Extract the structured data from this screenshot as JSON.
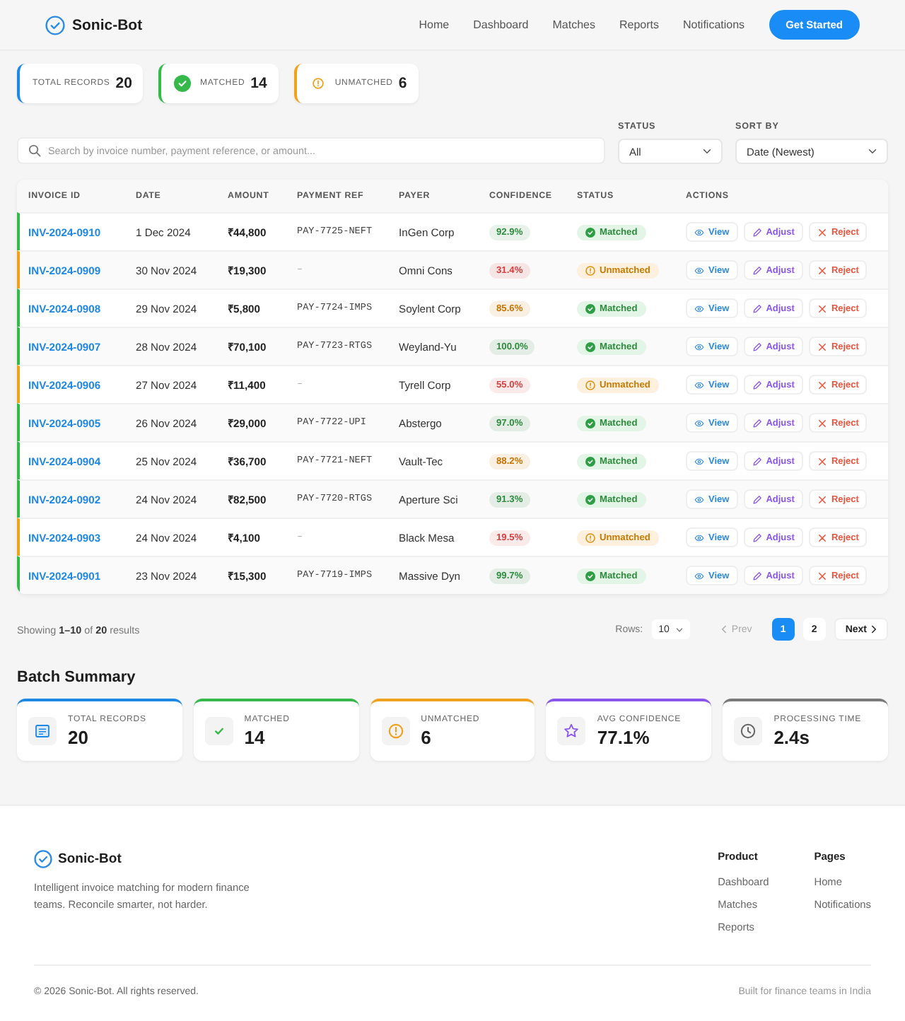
{
  "header": {
    "brand": "Sonic-Bot",
    "nav": [
      "Home",
      "Dashboard",
      "Matches",
      "Reports",
      "Notifications"
    ],
    "cta": "Get Started"
  },
  "stats": [
    {
      "kind": "total",
      "label": "TOTAL RECORDS",
      "value": "20"
    },
    {
      "kind": "matched",
      "label": "MATCHED",
      "value": "14"
    },
    {
      "kind": "unmatched",
      "label": "UNMATCHED",
      "value": "6"
    }
  ],
  "filters": {
    "search": {
      "placeholder": "Search by invoice number, payment reference, or amount..."
    },
    "status": {
      "label": "STATUS",
      "value": "All"
    },
    "sort": {
      "label": "SORT BY",
      "value": "Date (Newest)"
    }
  },
  "table": {
    "columns": [
      "INVOICE ID",
      "DATE",
      "AMOUNT",
      "PAYMENT REF",
      "PAYER",
      "CONFIDENCE",
      "STATUS",
      "ACTIONS"
    ],
    "rows": [
      {
        "invoice_id": "INV-2024-0910",
        "date": "1 Dec 2024",
        "amount": "₹44,800",
        "payment_ref": "PAY-7725-NEFT",
        "payer": "InGen Corp",
        "confidence": {
          "value": "92.9%",
          "color": "#2e8b3e"
        },
        "matched": true,
        "status": "Matched",
        "actions": [
          {
            "kind": "view",
            "label": "View"
          },
          {
            "kind": "adjust",
            "label": "Adjust"
          },
          {
            "kind": "reject",
            "label": "Reject"
          }
        ]
      },
      {
        "invoice_id": "INV-2024-0909",
        "date": "30 Nov 2024",
        "amount": "₹19,300",
        "payment_ref": "–",
        "payer": "Omni Cons",
        "confidence": {
          "value": "31.4%",
          "color": "#d84040"
        },
        "matched": false,
        "status": "Unmatched",
        "actions": [
          {
            "kind": "view",
            "label": "View"
          },
          {
            "kind": "adjust",
            "label": "Adjust"
          },
          {
            "kind": "reject",
            "label": "Reject"
          }
        ]
      },
      {
        "invoice_id": "INV-2024-0908",
        "date": "29 Nov 2024",
        "amount": "₹5,800",
        "payment_ref": "PAY-7724-IMPS",
        "payer": "Soylent Corp",
        "confidence": {
          "value": "85.6%",
          "color": "#c77400"
        },
        "matched": true,
        "status": "Matched",
        "actions": [
          {
            "kind": "view",
            "label": "View"
          },
          {
            "kind": "adjust",
            "label": "Adjust"
          },
          {
            "kind": "reject",
            "label": "Reject"
          }
        ]
      },
      {
        "invoice_id": "INV-2024-0907",
        "date": "28 Nov 2024",
        "amount": "₹70,100",
        "payment_ref": "PAY-7723-RTGS",
        "payer": "Weyland-Yu",
        "confidence": {
          "value": "100.0%",
          "color": "#2e8b3e"
        },
        "matched": true,
        "status": "Matched",
        "actions": [
          {
            "kind": "view",
            "label": "View"
          },
          {
            "kind": "adjust",
            "label": "Adjust"
          },
          {
            "kind": "reject",
            "label": "Reject"
          }
        ]
      },
      {
        "invoice_id": "INV-2024-0906",
        "date": "27 Nov 2024",
        "amount": "₹11,400",
        "payment_ref": "–",
        "payer": "Tyrell Corp",
        "confidence": {
          "value": "55.0%",
          "color": "#d84040"
        },
        "matched": false,
        "status": "Unmatched",
        "actions": [
          {
            "kind": "view",
            "label": "View"
          },
          {
            "kind": "adjust",
            "label": "Adjust"
          },
          {
            "kind": "reject",
            "label": "Reject"
          }
        ]
      },
      {
        "invoice_id": "INV-2024-0905",
        "date": "26 Nov 2024",
        "amount": "₹29,000",
        "payment_ref": "PAY-7722-UPI",
        "payer": "Abstergo",
        "confidence": {
          "value": "97.0%",
          "color": "#2e8b3e"
        },
        "matched": true,
        "status": "Matched",
        "actions": [
          {
            "kind": "view",
            "label": "View"
          },
          {
            "kind": "adjust",
            "label": "Adjust"
          },
          {
            "kind": "reject",
            "label": "Reject"
          }
        ]
      },
      {
        "invoice_id": "INV-2024-0904",
        "date": "25 Nov 2024",
        "amount": "₹36,700",
        "payment_ref": "PAY-7721-NEFT",
        "payer": "Vault-Tec",
        "confidence": {
          "value": "88.2%",
          "color": "#c77400"
        },
        "matched": true,
        "status": "Matched",
        "actions": [
          {
            "kind": "view",
            "label": "View"
          },
          {
            "kind": "adjust",
            "label": "Adjust"
          },
          {
            "kind": "reject",
            "label": "Reject"
          }
        ]
      },
      {
        "invoice_id": "INV-2024-0902",
        "date": "24 Nov 2024",
        "amount": "₹82,500",
        "payment_ref": "PAY-7720-RTGS",
        "payer": "Aperture Sci",
        "confidence": {
          "value": "91.3%",
          "color": "#2e8b3e"
        },
        "matched": true,
        "status": "Matched",
        "actions": [
          {
            "kind": "view",
            "label": "View"
          },
          {
            "kind": "adjust",
            "label": "Adjust"
          },
          {
            "kind": "reject",
            "label": "Reject"
          }
        ]
      },
      {
        "invoice_id": "INV-2024-0903",
        "date": "24 Nov 2024",
        "amount": "₹4,100",
        "payment_ref": "–",
        "payer": "Black Mesa",
        "confidence": {
          "value": "19.5%",
          "color": "#d84040"
        },
        "matched": false,
        "status": "Unmatched",
        "actions": [
          {
            "kind": "view",
            "label": "View"
          },
          {
            "kind": "adjust",
            "label": "Adjust"
          },
          {
            "kind": "reject",
            "label": "Reject"
          }
        ]
      },
      {
        "invoice_id": "INV-2024-0901",
        "date": "23 Nov 2024",
        "amount": "₹15,300",
        "payment_ref": "PAY-7719-IMPS",
        "payer": "Massive Dyn",
        "confidence": {
          "value": "99.7%",
          "color": "#2e8b3e"
        },
        "matched": true,
        "status": "Matched",
        "actions": [
          {
            "kind": "view",
            "label": "View"
          },
          {
            "kind": "adjust",
            "label": "Adjust"
          },
          {
            "kind": "reject",
            "label": "Reject"
          }
        ]
      }
    ]
  },
  "pagination": {
    "summary": "Showing **1–10** of **20** results",
    "rows_label": "Rows:",
    "rows_value": "10",
    "prev": {
      "label": "Prev",
      "disabled": true
    },
    "pages": [
      {
        "label": "1",
        "selected": true
      },
      {
        "label": "2",
        "selected": false
      }
    ],
    "next": {
      "label": "Next",
      "disabled": false
    }
  },
  "batch_summary": {
    "title": "Batch Summary",
    "cards": [
      {
        "kind": "total",
        "label": "TOTAL RECORDS",
        "value": "20"
      },
      {
        "kind": "matched",
        "label": "MATCHED",
        "value": "14"
      },
      {
        "kind": "unmatched",
        "label": "UNMATCHED",
        "value": "6"
      },
      {
        "kind": "confidence",
        "label": "AVG CONFIDENCE",
        "value": "77.1%"
      },
      {
        "kind": "time",
        "label": "PROCESSING TIME",
        "value": "2.4s"
      }
    ]
  },
  "footer": {
    "brand": "Sonic-Bot",
    "description": "Intelligent invoice matching for modern finance teams. Reconcile smarter, not harder.",
    "columns": [
      {
        "title": "Product",
        "links": [
          "Dashboard",
          "Matches",
          "Reports"
        ]
      },
      {
        "title": "Pages",
        "links": [
          "Home",
          "Notifications"
        ]
      }
    ],
    "copyright": "© 2026 Sonic-Bot. All rights reserved.",
    "tagline": "Built for finance teams in India"
  }
}
